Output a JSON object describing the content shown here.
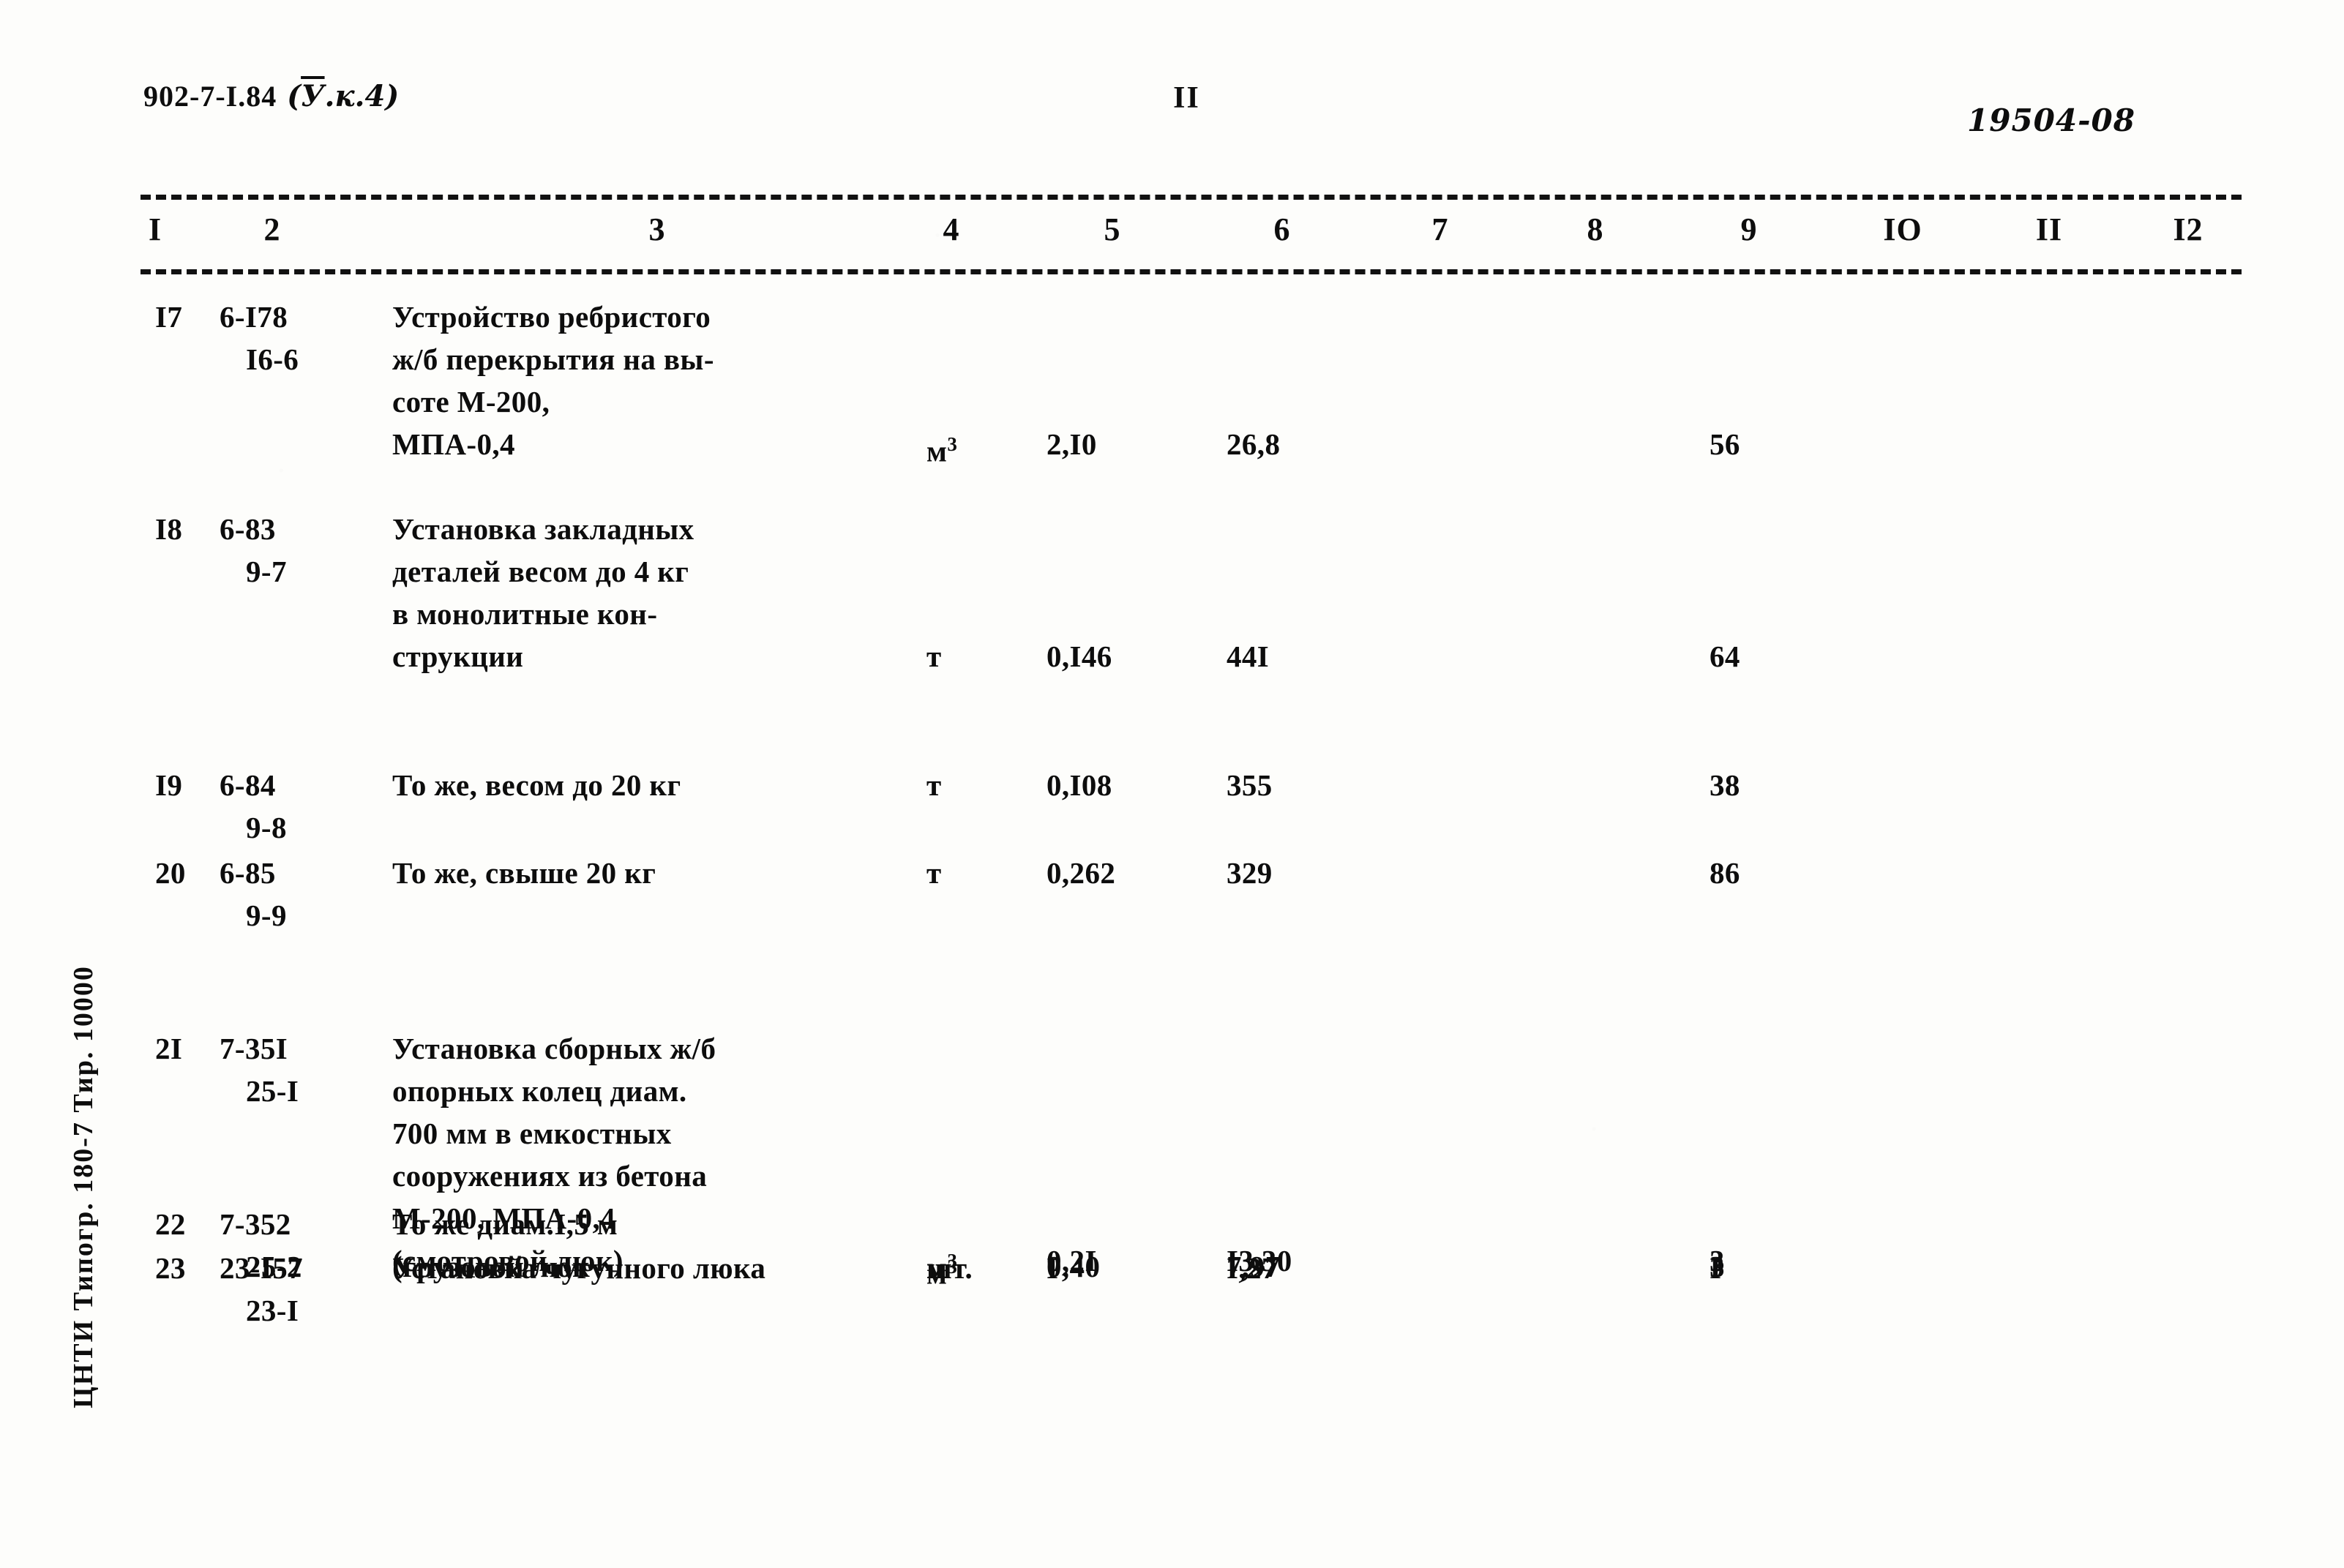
{
  "page": {
    "doc_code": "902-7-I.84",
    "doc_code_annotation": "(У.к.4)",
    "annotation_letter": "У",
    "annotation_rest": ".к.4",
    "page_number": "II",
    "archive_number": "19504-08",
    "imprint": "ЦНТИ Типогр. 180-7 Тир. 10000"
  },
  "table": {
    "column_headers": [
      "I",
      "2",
      "3",
      "4",
      "5",
      "6",
      "7",
      "8",
      "9",
      "IO",
      "II",
      "I2"
    ],
    "rows": [
      {
        "num": "I7",
        "code1": "6-I78",
        "code2": "I6-6",
        "desc_lines": [
          "Устройство ребристого",
          "ж/б перекрытия на вы-",
          "соте М-200,",
          "МПА-0,4"
        ],
        "unit": "м",
        "unit_sup": "3",
        "col5": "2,I0",
        "col6": "26,8",
        "col7": "",
        "col8": "",
        "col9": "56",
        "col10": "",
        "col11": "",
        "col12": ""
      },
      {
        "num": "I8",
        "code1": "6-83",
        "code2": "9-7",
        "desc_lines": [
          "Установка закладных",
          "деталей весом до 4 кг",
          "в монолитные кон-",
          "струкции"
        ],
        "unit": "т",
        "unit_sup": "",
        "col5": "0,I46",
        "col6": "44I",
        "col7": "",
        "col8": "",
        "col9": "64",
        "col10": "",
        "col11": "",
        "col12": ""
      },
      {
        "num": "I9",
        "code1": "6-84",
        "code2": "9-8",
        "desc_lines": [
          "То же, весом до 20 кг"
        ],
        "unit": "т",
        "unit_sup": "",
        "col5": "0,I08",
        "col6": "355",
        "col7": "",
        "col8": "",
        "col9": "38",
        "col10": "",
        "col11": "",
        "col12": ""
      },
      {
        "num": "20",
        "code1": "6-85",
        "code2": "9-9",
        "desc_lines": [
          "То же, свыше 20 кг"
        ],
        "unit": "т",
        "unit_sup": "",
        "col5": "0,262",
        "col6": "329",
        "col7": "",
        "col8": "",
        "col9": "86",
        "col10": "",
        "col11": "",
        "col12": ""
      },
      {
        "num": "2I",
        "code1": "7-35I",
        "code2": "25-I",
        "desc_lines": [
          "Установка сборных ж/б",
          "опорных колец диам.",
          "700 мм в емкостных",
          "сооружениях из бетона",
          "М-200, МПА-0,4",
          "(смотровой люк)"
        ],
        "unit": "м",
        "unit_sup": "3",
        "col5": "0,2I",
        "col6": "I3,30",
        "col7": "",
        "col8": "",
        "col9": "3",
        "col10": "",
        "col11": "",
        "col12": ""
      },
      {
        "num": "22",
        "code1": "7-352",
        "code2": "25-2",
        "desc_lines": [
          "То же диам.I,5 м",
          "(грузовой люк"
        ],
        "unit": "м",
        "unit_sup": "3",
        "col5": "0,40",
        "col6": "7,97",
        "col7": "",
        "col8": "",
        "col9": "3",
        "col10": "",
        "col11": "",
        "col12": ""
      },
      {
        "num": "23",
        "code1": "23-I57",
        "code2": "23-I",
        "desc_lines": [
          "Установка чугунного люка"
        ],
        "unit": "шт.",
        "unit_sup": "",
        "col5": "I",
        "col6": "I,27",
        "col7": "",
        "col8": "",
        "col9": "I",
        "col10": "",
        "col11": "",
        "col12": ""
      }
    ]
  }
}
